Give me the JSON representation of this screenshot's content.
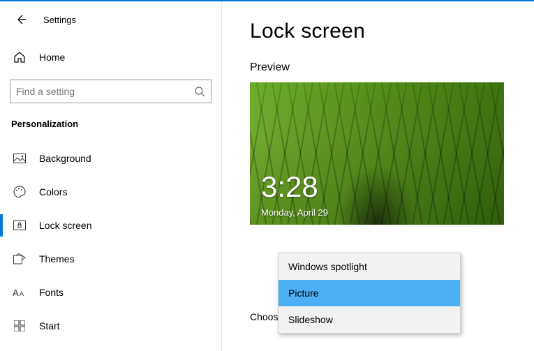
{
  "header": {
    "title": "Settings"
  },
  "home_label": "Home",
  "search": {
    "placeholder": "Find a setting"
  },
  "section_label": "Personalization",
  "nav": [
    {
      "label": "Background"
    },
    {
      "label": "Colors"
    },
    {
      "label": "Lock screen"
    },
    {
      "label": "Themes"
    },
    {
      "label": "Fonts"
    },
    {
      "label": "Start"
    }
  ],
  "main": {
    "title": "Lock screen",
    "preview_label": "Preview",
    "preview_time": "3:28",
    "preview_date": "Monday, April 29",
    "choose_label": "Choose your picture"
  },
  "dropdown": {
    "items": [
      {
        "label": "Windows spotlight"
      },
      {
        "label": "Picture"
      },
      {
        "label": "Slideshow"
      }
    ]
  }
}
